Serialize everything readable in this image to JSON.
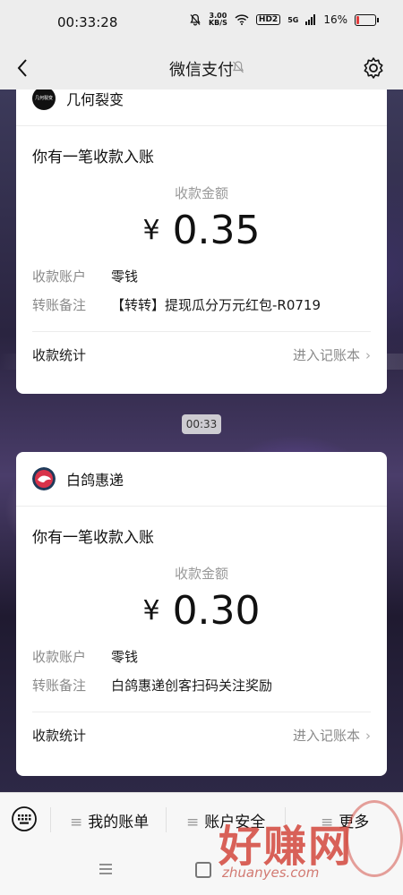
{
  "status_bar": {
    "time": "00:33:28",
    "net_speed_value": "3.00",
    "net_speed_unit": "KB/S",
    "hd_label": "HD2",
    "signal_label": "5G",
    "battery_text": "16%",
    "battery_level": 0.16
  },
  "nav": {
    "title": "微信支付"
  },
  "cards": [
    {
      "merchant": "几何裂变",
      "logo_text": "几何裂变",
      "heading": "你有一笔收款入账",
      "amount_label": "收款金额",
      "currency": "¥",
      "amount": "0.35",
      "account_key": "收款账户",
      "account_value": "零钱",
      "note_key": "转账备注",
      "note_value": "【转转】提现瓜分万元红包-R0719",
      "stats_label": "收款统计",
      "ledger_label": "进入记账本"
    },
    {
      "merchant": "白鸽惠递",
      "heading": "你有一笔收款入账",
      "amount_label": "收款金额",
      "currency": "¥",
      "amount": "0.30",
      "account_key": "收款账户",
      "account_value": "零钱",
      "note_key": "转账备注",
      "note_value": "白鸽惠递创客扫码关注奖励",
      "stats_label": "收款统计",
      "ledger_label": "进入记账本"
    }
  ],
  "timestamp": "00:33",
  "bottom_menu": {
    "items": [
      "我的账单",
      "账户安全",
      "更多"
    ]
  },
  "watermark": {
    "text": "好赚网",
    "url": "zhuanyes.com"
  },
  "colors": {
    "accent_red": "#e23b3b",
    "nav_bg": "#ededed"
  }
}
